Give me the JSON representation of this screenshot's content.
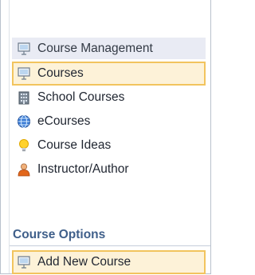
{
  "section": {
    "title": "Course Management",
    "icon": "presentation-board-icon"
  },
  "nav": {
    "items": [
      {
        "label": "Courses",
        "icon": "presentation-board-icon",
        "selected": true
      },
      {
        "label": "School Courses",
        "icon": "building-icon",
        "selected": false
      },
      {
        "label": "eCourses",
        "icon": "globe-icon",
        "selected": false
      },
      {
        "label": "Course Ideas",
        "icon": "lightbulb-icon",
        "selected": false
      },
      {
        "label": "Instructor/Author",
        "icon": "person-icon",
        "selected": false
      }
    ]
  },
  "options": {
    "title": "Course Options",
    "add_new_label": "Add New Course",
    "add_new_icon": "presentation-board-icon"
  },
  "colors": {
    "header_bg": "#e9ebf4",
    "selected_bg": "#fdf2d8",
    "selected_border": "#f2c45e",
    "options_title": "#3f5f8a"
  }
}
